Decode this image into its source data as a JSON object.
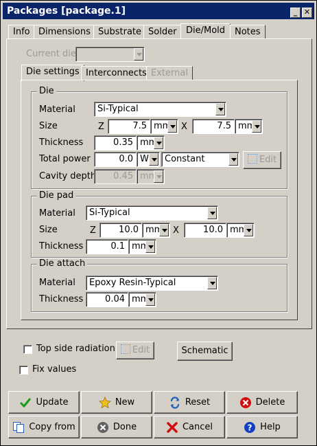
{
  "window": {
    "title": "Packages [package.1]",
    "min_glyph": "_",
    "close_glyph": "✕"
  },
  "tabs": [
    {
      "label": "Info",
      "active": false
    },
    {
      "label": "Dimensions",
      "active": false
    },
    {
      "label": "Substrate",
      "active": false
    },
    {
      "label": "Solder",
      "active": false
    },
    {
      "label": "Die/Mold",
      "active": true
    },
    {
      "label": "Notes",
      "active": false
    }
  ],
  "current_die": {
    "label": "Current die",
    "value": ""
  },
  "subtabs": [
    {
      "label": "Die settings",
      "active": true
    },
    {
      "label": "Interconnects",
      "active": false
    },
    {
      "label": "External",
      "disabled": true
    }
  ],
  "die": {
    "title": "Die",
    "material_label": "Material",
    "material": "Si-Typical",
    "size_label": "Size",
    "z_label": "Z",
    "x_label": "X",
    "size_z": "7.5",
    "size_z_unit": "mm",
    "size_x": "7.5",
    "size_x_unit": "mm",
    "thickness_label": "Thickness",
    "thickness": "0.35",
    "thickness_unit": "mm",
    "power_label": "Total power",
    "power": "0.0",
    "power_unit": "W",
    "power_mode": "Constant",
    "edit_label": "Edit",
    "cavity_label": "Cavity depth",
    "cavity": "0.45",
    "cavity_unit": "mm"
  },
  "die_pad": {
    "title": "Die pad",
    "material_label": "Material",
    "material": "Si-Typical",
    "size_label": "Size",
    "z_label": "Z",
    "x_label": "X",
    "size_z": "10.0",
    "size_z_unit": "mm",
    "size_x": "10.0",
    "size_x_unit": "mm",
    "thickness_label": "Thickness",
    "thickness": "0.1",
    "thickness_unit": "mm"
  },
  "die_attach": {
    "title": "Die attach",
    "material_label": "Material",
    "material": "Epoxy Resin-Typical",
    "thickness_label": "Thickness",
    "thickness": "0.04",
    "thickness_unit": "mm"
  },
  "options": {
    "top_radiation_label": "Top side radiation",
    "edit_label": "Edit",
    "schematic_label": "Schematic",
    "fix_values_label": "Fix values"
  },
  "buttons": {
    "update": "Update",
    "new": "New",
    "reset": "Reset",
    "delete": "Delete",
    "copy_from": "Copy from",
    "done": "Done",
    "cancel": "Cancel",
    "help": "Help"
  },
  "icons": {
    "update": "check-icon",
    "new": "star-icon",
    "reset": "recycle-icon",
    "delete": "delete-icon",
    "copy_from": "copy-icon",
    "done": "done-icon",
    "cancel": "cancel-icon",
    "help": "help-icon"
  },
  "colors": {
    "titlebar": "#0a246a",
    "face": "#d4d0c8",
    "check": "#1a9a1a",
    "star": "#f0c020",
    "delete": "#d01010",
    "help": "#1040c0"
  }
}
